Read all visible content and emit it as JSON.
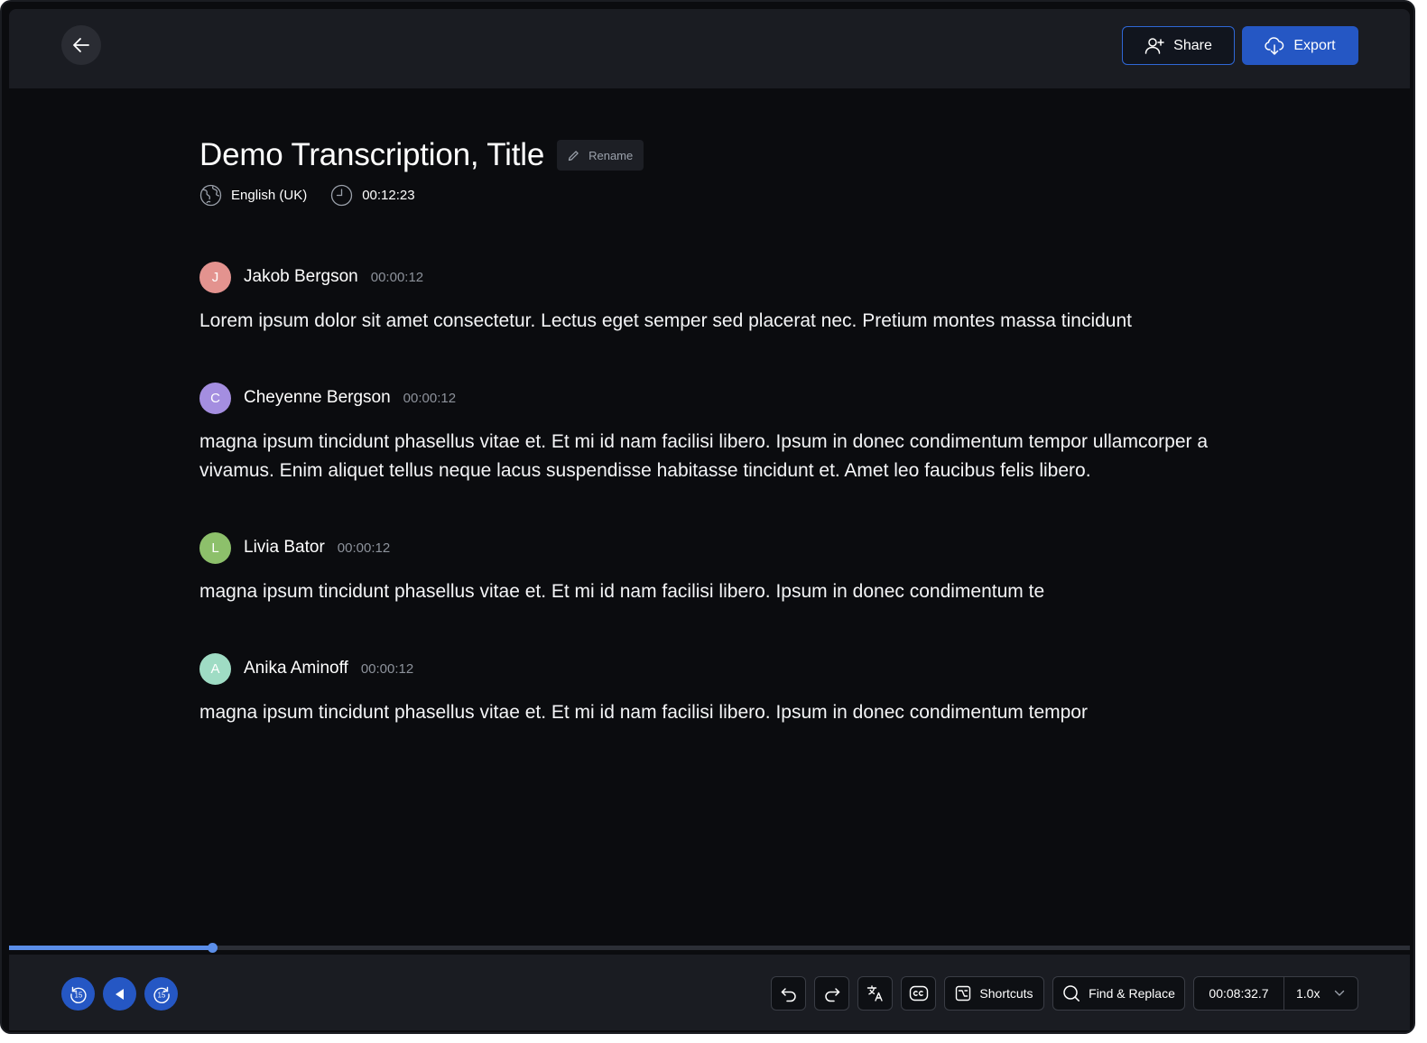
{
  "header": {
    "back_icon": "arrow-left-icon",
    "share_label": "Share",
    "export_label": "Export",
    "accent": "#2557c4"
  },
  "document": {
    "title": "Demo Transcription, Title",
    "rename_label": "Rename",
    "language": "English (UK)",
    "duration": "00:12:23"
  },
  "entries": [
    {
      "initial": "J",
      "avatar_color": "#e3938f",
      "speaker": "Jakob Bergson",
      "time": "00:00:12",
      "text": "Lorem ipsum dolor sit amet consectetur. Lectus eget semper sed placerat nec. Pretium montes massa tincidunt"
    },
    {
      "initial": "C",
      "avatar_color": "#a48ee0",
      "speaker": "Cheyenne Bergson",
      "time": "00:00:12",
      "text": "magna ipsum tincidunt phasellus vitae et. Et mi id nam facilisi libero. Ipsum in donec condimentum tempor ullamcorper a vivamus. Enim aliquet tellus neque lacus suspendisse habitasse tincidunt et. Amet leo faucibus felis libero."
    },
    {
      "initial": "L",
      "avatar_color": "#8dc06b",
      "speaker": "Livia Bator",
      "time": "00:00:12",
      "text": "magna ipsum tincidunt phasellus vitae et. Et mi id nam facilisi libero. Ipsum in donec condimentum te"
    },
    {
      "initial": "A",
      "avatar_color": "#9fdcc4",
      "speaker": "Anika Aminoff",
      "time": "00:00:12",
      "text": "magna ipsum tincidunt phasellus vitae et. Et mi id nam facilisi libero. Ipsum in donec condimentum tempor"
    }
  ],
  "player": {
    "progress": 0.145,
    "rewind_label": "15",
    "forward_label": "15",
    "shortcuts_label": "Shortcuts",
    "find_replace_label": "Find & Replace",
    "current_time": "00:08:32.7",
    "speed": "1.0x"
  }
}
